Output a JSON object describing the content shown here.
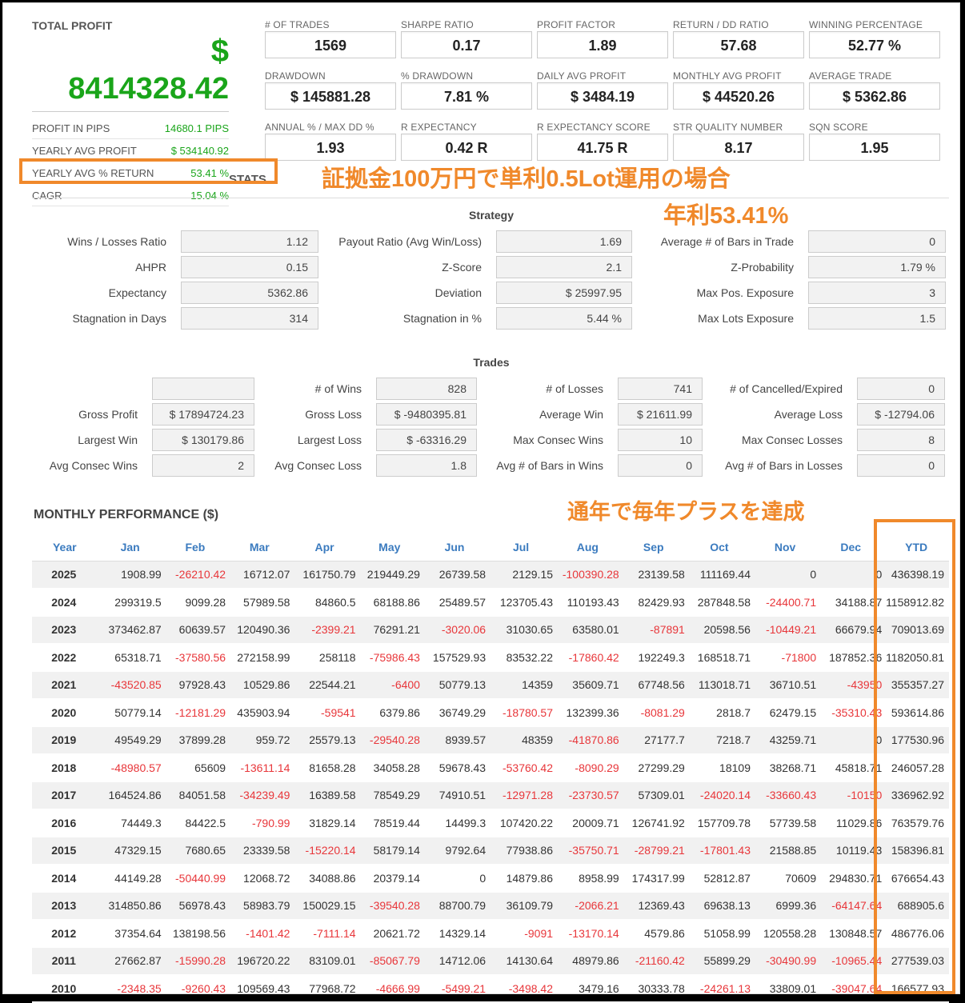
{
  "total_profit": {
    "label": "TOTAL PROFIT",
    "currency": "$",
    "value": "8414328.42",
    "rows": [
      {
        "label": "PROFIT IN PIPS",
        "value": "14680.1 PIPS"
      },
      {
        "label": "YEARLY AVG PROFIT",
        "value": "$ 534140.92"
      },
      {
        "label": "YEARLY AVG % RETURN",
        "value": "53.41 %"
      },
      {
        "label": "CAGR",
        "value": "15.04 %"
      }
    ]
  },
  "metrics": [
    {
      "label": "# OF TRADES",
      "value": "1569"
    },
    {
      "label": "SHARPE RATIO",
      "value": "0.17"
    },
    {
      "label": "PROFIT FACTOR",
      "value": "1.89"
    },
    {
      "label": "RETURN / DD RATIO",
      "value": "57.68"
    },
    {
      "label": "WINNING PERCENTAGE",
      "value": "52.77 %"
    },
    {
      "label": "DRAWDOWN",
      "value": "$ 145881.28"
    },
    {
      "label": "% DRAWDOWN",
      "value": "7.81 %"
    },
    {
      "label": "DAILY AVG PROFIT",
      "value": "$ 3484.19"
    },
    {
      "label": "MONTHLY AVG PROFIT",
      "value": "$ 44520.26"
    },
    {
      "label": "AVERAGE TRADE",
      "value": "$ 5362.86"
    },
    {
      "label": "ANNUAL % / MAX DD %",
      "value": "1.93"
    },
    {
      "label": "R EXPECTANCY",
      "value": "0.42 R"
    },
    {
      "label": "R EXPECTANCY SCORE",
      "value": "41.75 R"
    },
    {
      "label": "STR QUALITY NUMBER",
      "value": "8.17"
    },
    {
      "label": "SQN SCORE",
      "value": "1.95"
    }
  ],
  "annotations": {
    "line1": "証拠金100万円で単利0.5Lot運用の場合",
    "line2": "年利53.41%",
    "line3": "通年で毎年プラスを達成"
  },
  "stats_ghost": "STATS",
  "strategy": {
    "title": "Strategy",
    "rows": [
      [
        {
          "label": "Wins / Losses Ratio",
          "value": "1.12"
        },
        {
          "label": "Payout Ratio (Avg Win/Loss)",
          "value": "1.69"
        },
        {
          "label": "Average # of Bars in Trade",
          "value": "0"
        }
      ],
      [
        {
          "label": "AHPR",
          "value": "0.15"
        },
        {
          "label": "Z-Score",
          "value": "2.1"
        },
        {
          "label": "Z-Probability",
          "value": "1.79 %"
        }
      ],
      [
        {
          "label": "Expectancy",
          "value": "5362.86"
        },
        {
          "label": "Deviation",
          "value": "$ 25997.95"
        },
        {
          "label": "Max Pos. Exposure",
          "value": "3"
        }
      ],
      [
        {
          "label": "Stagnation in Days",
          "value": "314"
        },
        {
          "label": "Stagnation in %",
          "value": "5.44 %"
        },
        {
          "label": "Max Lots Exposure",
          "value": "1.5"
        }
      ]
    ]
  },
  "trades": {
    "title": "Trades",
    "rows": [
      [
        {
          "label": "",
          "value": ""
        },
        {
          "label": "# of Wins",
          "value": "828"
        },
        {
          "label": "# of Losses",
          "value": "741"
        },
        {
          "label": "# of Cancelled/Expired",
          "value": "0"
        }
      ],
      [
        {
          "label": "Gross Profit",
          "value": "$ 17894724.23"
        },
        {
          "label": "Gross Loss",
          "value": "$ -9480395.81"
        },
        {
          "label": "Average Win",
          "value": "$ 21611.99"
        },
        {
          "label": "Average Loss",
          "value": "$ -12794.06"
        }
      ],
      [
        {
          "label": "Largest Win",
          "value": "$ 130179.86"
        },
        {
          "label": "Largest Loss",
          "value": "$ -63316.29"
        },
        {
          "label": "Max Consec Wins",
          "value": "10"
        },
        {
          "label": "Max Consec Losses",
          "value": "8"
        }
      ],
      [
        {
          "label": "Avg Consec Wins",
          "value": "2"
        },
        {
          "label": "Avg Consec Loss",
          "value": "1.8"
        },
        {
          "label": "Avg # of Bars in Wins",
          "value": "0"
        },
        {
          "label": "Avg # of Bars in Losses",
          "value": "0"
        }
      ]
    ]
  },
  "monthly": {
    "title": "MONTHLY PERFORMANCE ($)",
    "headers": [
      "Year",
      "Jan",
      "Feb",
      "Mar",
      "Apr",
      "May",
      "Jun",
      "Jul",
      "Aug",
      "Sep",
      "Oct",
      "Nov",
      "Dec",
      "YTD"
    ],
    "rows": [
      [
        "2025",
        "1908.99",
        "-26210.42",
        "16712.07",
        "161750.79",
        "219449.29",
        "26739.58",
        "2129.15",
        "-100390.28",
        "23139.58",
        "111169.44",
        "0",
        "0",
        "436398.19"
      ],
      [
        "2024",
        "299319.5",
        "9099.28",
        "57989.58",
        "84860.5",
        "68188.86",
        "25489.57",
        "123705.43",
        "110193.43",
        "82429.93",
        "287848.58",
        "-24400.71",
        "34188.87",
        "1158912.82"
      ],
      [
        "2023",
        "373462.87",
        "60639.57",
        "120490.36",
        "-2399.21",
        "76291.21",
        "-3020.06",
        "31030.65",
        "63580.01",
        "-87891",
        "20598.56",
        "-10449.21",
        "66679.94",
        "709013.69"
      ],
      [
        "2022",
        "65318.71",
        "-37580.56",
        "272158.99",
        "258118",
        "-75986.43",
        "157529.93",
        "83532.22",
        "-17860.42",
        "192249.3",
        "168518.71",
        "-71800",
        "187852.36",
        "1182050.81"
      ],
      [
        "2021",
        "-43520.85",
        "97928.43",
        "10529.86",
        "22544.21",
        "-6400",
        "50779.13",
        "14359",
        "35609.71",
        "67748.56",
        "113018.71",
        "36710.51",
        "-43950",
        "355357.27"
      ],
      [
        "2020",
        "50779.14",
        "-12181.29",
        "435903.94",
        "-59541",
        "6379.86",
        "36749.29",
        "-18780.57",
        "132399.36",
        "-8081.29",
        "2818.7",
        "62479.15",
        "-35310.43",
        "593614.86"
      ],
      [
        "2019",
        "49549.29",
        "37899.28",
        "959.72",
        "25579.13",
        "-29540.28",
        "8939.57",
        "48359",
        "-41870.86",
        "27177.7",
        "7218.7",
        "43259.71",
        "0",
        "177530.96"
      ],
      [
        "2018",
        "-48980.57",
        "65609",
        "-13611.14",
        "81658.28",
        "34058.28",
        "59678.43",
        "-53760.42",
        "-8090.29",
        "27299.29",
        "18109",
        "38268.71",
        "45818.71",
        "246057.28"
      ],
      [
        "2017",
        "164524.86",
        "84051.58",
        "-34239.49",
        "16389.58",
        "78549.29",
        "74910.51",
        "-12971.28",
        "-23730.57",
        "57309.01",
        "-24020.14",
        "-33660.43",
        "-10150",
        "336962.92"
      ],
      [
        "2016",
        "74449.3",
        "84422.5",
        "-790.99",
        "31829.14",
        "78519.44",
        "14499.3",
        "107420.22",
        "20009.71",
        "126741.92",
        "157709.78",
        "57739.58",
        "11029.86",
        "763579.76"
      ],
      [
        "2015",
        "47329.15",
        "7680.65",
        "23339.58",
        "-15220.14",
        "58179.14",
        "9792.64",
        "77938.86",
        "-35750.71",
        "-28799.21",
        "-17801.43",
        "21588.85",
        "10119.43",
        "158396.81"
      ],
      [
        "2014",
        "44149.28",
        "-50440.99",
        "12068.72",
        "34088.86",
        "20379.14",
        "0",
        "14879.86",
        "8958.99",
        "174317.99",
        "52812.87",
        "70609",
        "294830.71",
        "676654.43"
      ],
      [
        "2013",
        "314850.86",
        "56978.43",
        "58983.79",
        "150029.15",
        "-39540.28",
        "88700.79",
        "36109.79",
        "-2066.21",
        "12369.43",
        "69638.13",
        "6999.36",
        "-64147.64",
        "688905.6"
      ],
      [
        "2012",
        "37354.64",
        "138198.56",
        "-1401.42",
        "-7111.14",
        "20621.72",
        "14329.14",
        "-9091",
        "-13170.14",
        "4579.86",
        "51058.99",
        "120558.28",
        "130848.57",
        "486776.06"
      ],
      [
        "2011",
        "27662.87",
        "-15990.28",
        "196720.22",
        "83109.01",
        "-85067.79",
        "14712.06",
        "14130.64",
        "48979.86",
        "-21160.42",
        "55899.29",
        "-30490.99",
        "-10965.44",
        "277539.03"
      ],
      [
        "2010",
        "-2348.35",
        "-9260.43",
        "109569.43",
        "77968.72",
        "-4666.99",
        "-5499.21",
        "-3498.42",
        "3479.16",
        "30333.78",
        "-24261.13",
        "33809.01",
        "-39047.64",
        "166577.93"
      ]
    ]
  },
  "colors": {
    "positive": "#1aa51a",
    "negative": "#e8363a",
    "header_blue": "#3b7bbf",
    "annotation": "#f0892b"
  }
}
